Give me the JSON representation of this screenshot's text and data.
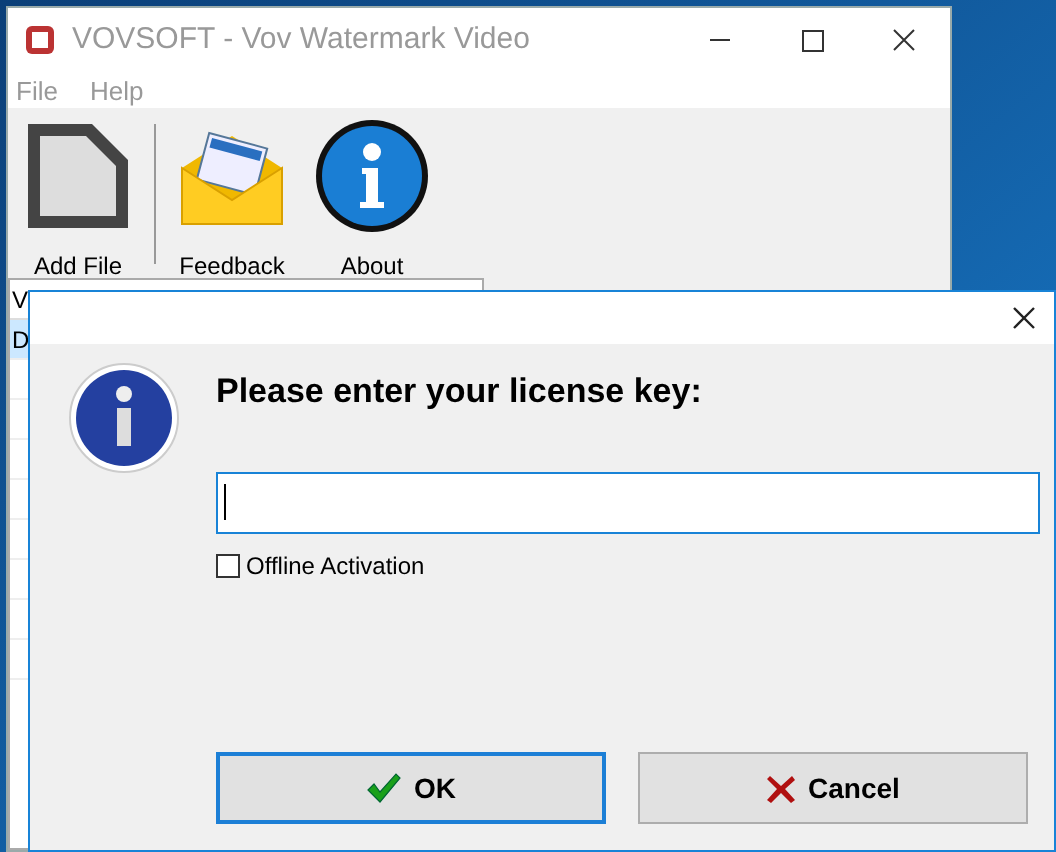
{
  "main_window": {
    "title": "VOVSOFT - Vov Watermark Video",
    "menu": [
      "File",
      "Help"
    ],
    "toolbar": [
      {
        "label": "Add File",
        "kind": "file"
      },
      {
        "label": "Feedback",
        "kind": "mail"
      },
      {
        "label": "About",
        "kind": "info"
      }
    ],
    "list": {
      "column_1": "V",
      "rows": [
        {
          "text": "D",
          "selected": true
        }
      ]
    }
  },
  "dialog": {
    "heading": "Please enter your license key:",
    "offline_activation": {
      "label": "Offline Activation",
      "checked": false
    },
    "buttons": [
      {
        "label": "OK",
        "kind": "ok",
        "default": true
      },
      {
        "label": "Cancel",
        "kind": "cancel",
        "default": false
      }
    ]
  }
}
